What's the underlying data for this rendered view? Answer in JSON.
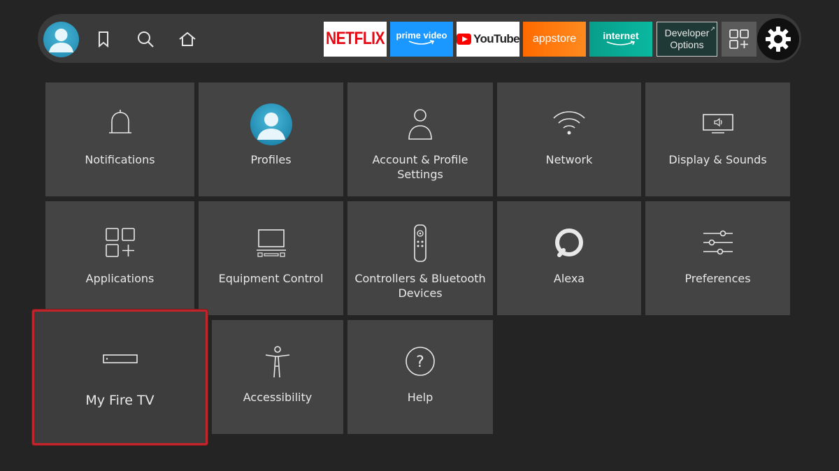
{
  "nav": {
    "profile_icon": "avatar-icon",
    "bookmark_icon": "bookmark-icon",
    "search_icon": "search-icon",
    "home_icon": "home-icon",
    "apps": [
      {
        "label": "NETFLIX"
      },
      {
        "label": "prime video"
      },
      {
        "label": "YouTube"
      },
      {
        "label": "appstore"
      },
      {
        "label": "internet"
      },
      {
        "label": "Developer Options"
      }
    ],
    "all_apps_icon": "grid-plus-icon",
    "settings_icon": "gear-icon"
  },
  "tiles": [
    {
      "label": "Notifications",
      "icon": "bell-icon"
    },
    {
      "label": "Profiles",
      "icon": "avatar-icon"
    },
    {
      "label": "Account & Profile Settings",
      "icon": "person-icon"
    },
    {
      "label": "Network",
      "icon": "wifi-icon"
    },
    {
      "label": "Display & Sounds",
      "icon": "tv-speaker-icon"
    },
    {
      "label": "Applications",
      "icon": "grid-plus-icon"
    },
    {
      "label": "Equipment Control",
      "icon": "monitor-icon"
    },
    {
      "label": "Controllers & Bluetooth Devices",
      "icon": "remote-icon"
    },
    {
      "label": "Alexa",
      "icon": "alexa-icon"
    },
    {
      "label": "Preferences",
      "icon": "sliders-icon"
    },
    {
      "label": "My Fire TV",
      "icon": "firetv-device-icon"
    },
    {
      "label": "Accessibility",
      "icon": "accessibility-icon"
    },
    {
      "label": "Help",
      "icon": "help-icon"
    }
  ],
  "colors": {
    "background": "#242424",
    "tile": "#444444",
    "focus_border": "#c2242b",
    "netflix_red": "#e50914",
    "prime_blue": "#1a98ff",
    "appstore_orange": "#ff7a10",
    "internet_teal": "#0bb8a0"
  }
}
